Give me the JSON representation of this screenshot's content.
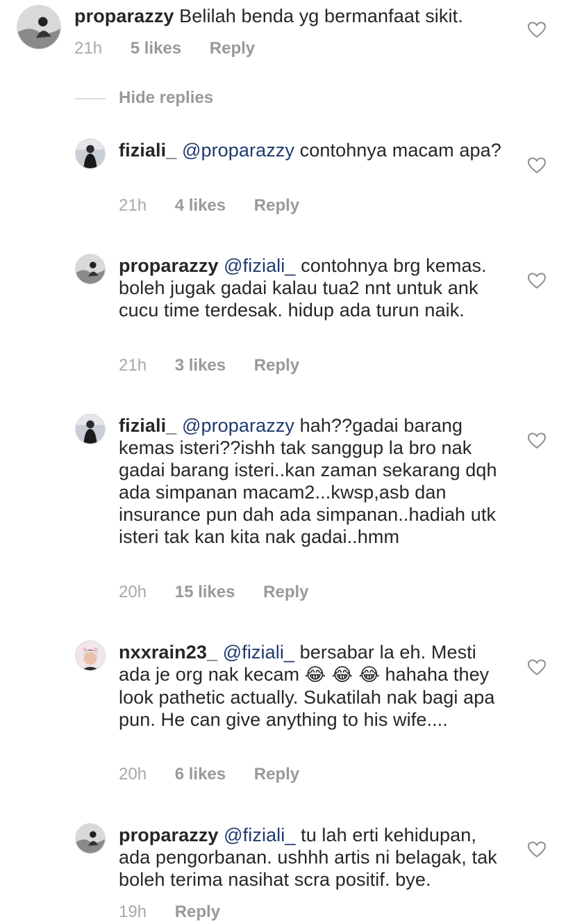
{
  "comments": [
    {
      "username": "proparazzy",
      "mention": "",
      "text": "Belilah benda yg bermanfaat sikit.",
      "time": "21h",
      "likes": "5 likes",
      "reply": "Reply"
    },
    {
      "username": "fiziali_",
      "mention": "@proparazzy",
      "text": "contohnya macam apa?",
      "time": "21h",
      "likes": "4 likes",
      "reply": "Reply"
    },
    {
      "username": "proparazzy",
      "mention": "@fiziali_",
      "text": "contohnya brg kemas. boleh jugak gadai kalau tua2 nnt untuk ank cucu time terdesak. hidup ada turun naik.",
      "time": "21h",
      "likes": "3 likes",
      "reply": "Reply"
    },
    {
      "username": "fiziali_",
      "mention": "@proparazzy",
      "text": "hah??gadai barang kemas isteri??ishh tak sanggup la bro nak gadai barang isteri..kan zaman sekarang dqh ada simpanan macam2...kwsp,asb dan insurance pun dah ada simpanan..hadiah utk isteri tak kan kita nak gadai..hmm",
      "time": "20h",
      "likes": "15 likes",
      "reply": "Reply"
    },
    {
      "username": "nxxrain23_",
      "mention": "@fiziali_",
      "text_before_emoji": "bersabar la eh. Mesti ada je org nak kecam",
      "emoji": "😂 😂 😂",
      "text_after_emoji": "hahaha they look pathetic actually. Sukatilah nak bagi apa pun. He can give anything to his wife....",
      "time": "20h",
      "likes": "6 likes",
      "reply": "Reply"
    },
    {
      "username": "proparazzy",
      "mention": "@fiziali_",
      "text": "tu lah erti kehidupan, ada pengorbanan. ushhh artis ni belagak, tak boleh terima nasihat scra positif. bye.",
      "time": "19h",
      "reply": "Reply"
    }
  ],
  "hide_replies": "Hide replies",
  "icons": {
    "like": "heart-outline-icon",
    "avatar": "user-avatar-photo"
  },
  "colors": {
    "text": "#262626",
    "meta": "#999999",
    "mention": "#1e3a6e"
  }
}
